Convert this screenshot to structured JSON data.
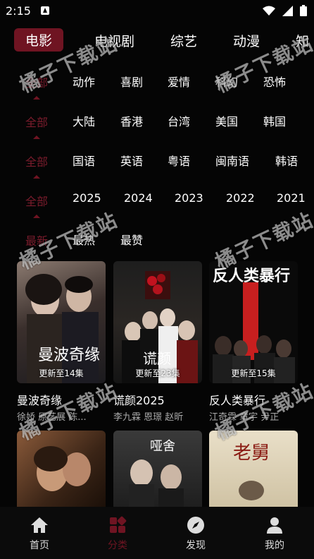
{
  "status": {
    "time": "2:15"
  },
  "categories": [
    "电影",
    "电视剧",
    "综艺",
    "动漫",
    "知"
  ],
  "filters": [
    {
      "lead": "全部",
      "options": [
        "动作",
        "喜剧",
        "爱情",
        "科幻",
        "恐怖"
      ]
    },
    {
      "lead": "全部",
      "options": [
        "大陆",
        "香港",
        "台湾",
        "美国",
        "韩国"
      ]
    },
    {
      "lead": "全部",
      "options": [
        "国语",
        "英语",
        "粤语",
        "闽南语",
        "韩语"
      ]
    },
    {
      "lead": "全部",
      "options": [
        "2025",
        "2024",
        "2023",
        "2022",
        "2021"
      ]
    },
    {
      "lead": "最新",
      "options": [
        "最热",
        "最赞"
      ]
    }
  ],
  "cards": [
    {
      "title": "曼波奇缘",
      "update": "更新至14集",
      "cast": "徐娇  原艺展  陈...",
      "poster_text": "曼波奇缘"
    },
    {
      "title": "谎颜2025",
      "update": "更新至23集",
      "cast": "李九霖  恩璟  赵昕",
      "poster_text": "谎颜"
    },
    {
      "title": "反人类暴行",
      "update": "更新至15集",
      "cast": "江奇霖  章宇  尹正",
      "poster_text": "反人类暴行"
    }
  ],
  "row2_posters": [
    {
      "poster_text": ""
    },
    {
      "poster_text": "哑舍"
    },
    {
      "poster_text": "老舅"
    }
  ],
  "nav": [
    {
      "label": "首页",
      "icon": "home-icon"
    },
    {
      "label": "分类",
      "icon": "category-icon"
    },
    {
      "label": "发现",
      "icon": "compass-icon"
    },
    {
      "label": "我的",
      "icon": "user-icon"
    }
  ],
  "watermark": "橘子下载站",
  "colors": {
    "accent": "#6f1422",
    "background": "#050505"
  }
}
